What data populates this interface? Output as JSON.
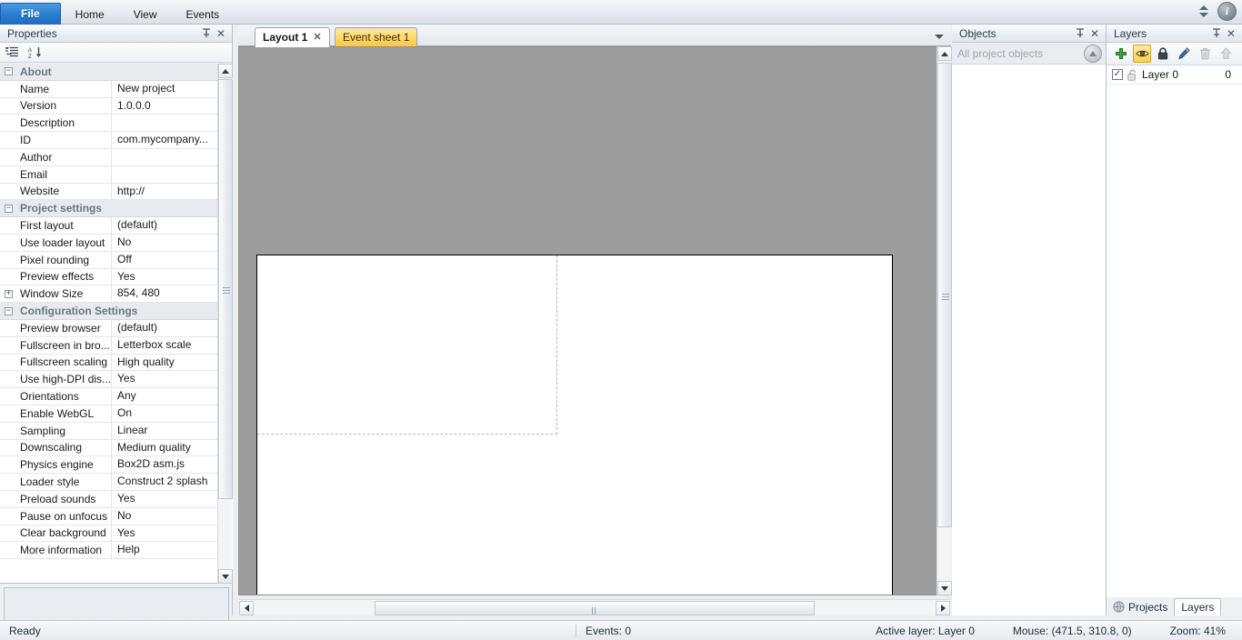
{
  "ribbon": {
    "tabs": [
      {
        "label": "File",
        "active": true
      },
      {
        "label": "Home",
        "active": false
      },
      {
        "label": "View",
        "active": false
      },
      {
        "label": "Events",
        "active": false
      }
    ],
    "info_label": "i",
    "accent_blue": "#2a7fd0"
  },
  "properties": {
    "title": "Properties",
    "pin_glyph": "⊓",
    "close_glyph": "✕",
    "toolbar": {
      "categorize_icon": "categorize-icon",
      "sort_icon": "alphabetical-sort-icon",
      "sort_label": "A\nZ"
    },
    "groups": [
      {
        "name": "About",
        "collapse_glyph": "−",
        "rows": [
          {
            "name": "Name",
            "value": "New project"
          },
          {
            "name": "Version",
            "value": "1.0.0.0"
          },
          {
            "name": "Description",
            "value": ""
          },
          {
            "name": "ID",
            "value": "com.mycompany..."
          },
          {
            "name": "Author",
            "value": ""
          },
          {
            "name": "Email",
            "value": ""
          },
          {
            "name": "Website",
            "value": "http://"
          }
        ]
      },
      {
        "name": "Project settings",
        "collapse_glyph": "−",
        "rows": [
          {
            "name": "First layout",
            "value": "(default)"
          },
          {
            "name": "Use loader layout",
            "value": "No"
          },
          {
            "name": "Pixel rounding",
            "value": "Off"
          },
          {
            "name": "Preview effects",
            "value": "Yes"
          },
          {
            "name": "Window Size",
            "value": "854, 480",
            "expandable": true,
            "expand_glyph": "+"
          }
        ]
      },
      {
        "name": "Configuration Settings",
        "collapse_glyph": "−",
        "rows": [
          {
            "name": "Preview browser",
            "value": "(default)"
          },
          {
            "name": "Fullscreen in bro...",
            "value": "Letterbox scale"
          },
          {
            "name": "Fullscreen scaling",
            "value": "High quality"
          },
          {
            "name": "Use high-DPI dis...",
            "value": "Yes"
          },
          {
            "name": "Orientations",
            "value": "Any"
          },
          {
            "name": "Enable WebGL",
            "value": "On"
          },
          {
            "name": "Sampling",
            "value": "Linear"
          },
          {
            "name": "Downscaling",
            "value": "Medium quality"
          },
          {
            "name": "Physics engine",
            "value": "Box2D asm.js"
          },
          {
            "name": "Loader style",
            "value": "Construct 2 splash"
          },
          {
            "name": "Preload sounds",
            "value": "Yes"
          },
          {
            "name": "Pause on unfocus",
            "value": "No"
          },
          {
            "name": "Clear background",
            "value": "Yes"
          },
          {
            "name": "More information",
            "value": "Help",
            "link": true
          }
        ]
      }
    ]
  },
  "layout_view": {
    "tabs": [
      {
        "label": "Layout 1",
        "active": true,
        "closable": true,
        "close_glyph": "✕"
      },
      {
        "label": "Event sheet 1",
        "active": false,
        "closable": false
      }
    ],
    "dropdown_icon": "chevron-down-icon",
    "canvas": {
      "background_color": "#9d9d9d",
      "page_color": "#ffffff",
      "guide_color": "#b9b9b9"
    }
  },
  "objects_panel": {
    "title": "Objects",
    "pin_glyph": "⊓",
    "close_glyph": "✕",
    "search_placeholder": "All project objects",
    "filter_button_icon": "circle-up-arrow-icon"
  },
  "layers_panel": {
    "title": "Layers",
    "pin_glyph": "⊓",
    "close_glyph": "✕",
    "toolbar": [
      {
        "name": "add-layer-button",
        "icon": "plus-icon",
        "state": "normal"
      },
      {
        "name": "toggle-visibility-button",
        "icon": "eye-icon",
        "state": "active"
      },
      {
        "name": "toggle-lock-button",
        "icon": "lock-icon",
        "state": "normal"
      },
      {
        "name": "rename-layer-button",
        "icon": "pencil-icon",
        "state": "normal"
      },
      {
        "name": "delete-layer-button",
        "icon": "trash-icon",
        "state": "disabled"
      },
      {
        "name": "move-layer-up-button",
        "icon": "arrow-up-icon",
        "state": "disabled"
      }
    ],
    "rows": [
      {
        "checked": true,
        "check_glyph": "✓",
        "locked": false,
        "name": "Layer 0",
        "index": "0"
      }
    ],
    "highlight_color": "#ffd24e"
  },
  "bottom_tabs": [
    {
      "label": "Projects",
      "active": false,
      "icon": "projects-icon"
    },
    {
      "label": "Layers",
      "active": true,
      "icon": ""
    }
  ],
  "statusbar": {
    "ready": "Ready",
    "events": "Events: 0",
    "active_layer": "Active layer: Layer 0",
    "mouse": "Mouse: (471.5, 310.8, 0)",
    "zoom": "Zoom: 41%"
  }
}
